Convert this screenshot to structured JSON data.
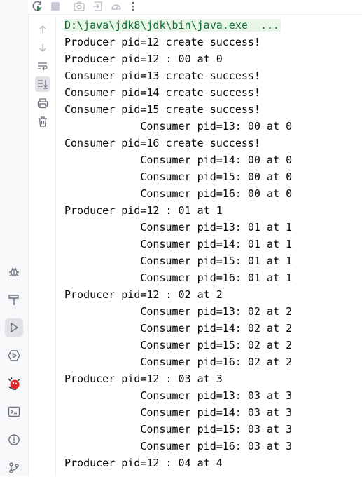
{
  "toolbar": {
    "icons": [
      "rerun-icon",
      "stop-icon",
      "screenshot-icon",
      "export-icon",
      "profiler-icon",
      "more-icon"
    ]
  },
  "gutter": {
    "icons": [
      "scroll-up-icon",
      "scroll-down-icon",
      "soft-wrap-icon",
      "scroll-to-end-icon",
      "print-icon",
      "clear-icon"
    ]
  },
  "sidebar": {
    "icons": [
      "debug-icon",
      "build-icon",
      "run-icon",
      "services-icon",
      "plugin-icon",
      "terminal-icon",
      "problems-icon",
      "git-icon"
    ]
  },
  "console": {
    "command": "D:\\java\\jdk8\\jdk\\bin\\java.exe  ...",
    "lines": [
      "Producer pid=12 create success!",
      "Producer pid=12 : 00 at 0",
      "Consumer pid=13 create success!",
      "Consumer pid=14 create success!",
      "Consumer pid=15 create success!",
      "            Consumer pid=13: 00 at 0",
      "Consumer pid=16 create success!",
      "            Consumer pid=14: 00 at 0",
      "            Consumer pid=15: 00 at 0",
      "            Consumer pid=16: 00 at 0",
      "Producer pid=12 : 01 at 1",
      "            Consumer pid=13: 01 at 1",
      "            Consumer pid=14: 01 at 1",
      "            Consumer pid=15: 01 at 1",
      "            Consumer pid=16: 01 at 1",
      "Producer pid=12 : 02 at 2",
      "            Consumer pid=13: 02 at 2",
      "            Consumer pid=14: 02 at 2",
      "            Consumer pid=15: 02 at 2",
      "            Consumer pid=16: 02 at 2",
      "Producer pid=12 : 03 at 3",
      "            Consumer pid=13: 03 at 3",
      "            Consumer pid=14: 03 at 3",
      "            Consumer pid=15: 03 at 3",
      "            Consumer pid=16: 03 at 3",
      "Producer pid=12 : 04 at 4"
    ]
  },
  "colors": {
    "command_text": "#0a6e31",
    "command_bg": "#e9f5e6",
    "output_text": "#080808",
    "run_icon": "#208a3c"
  }
}
